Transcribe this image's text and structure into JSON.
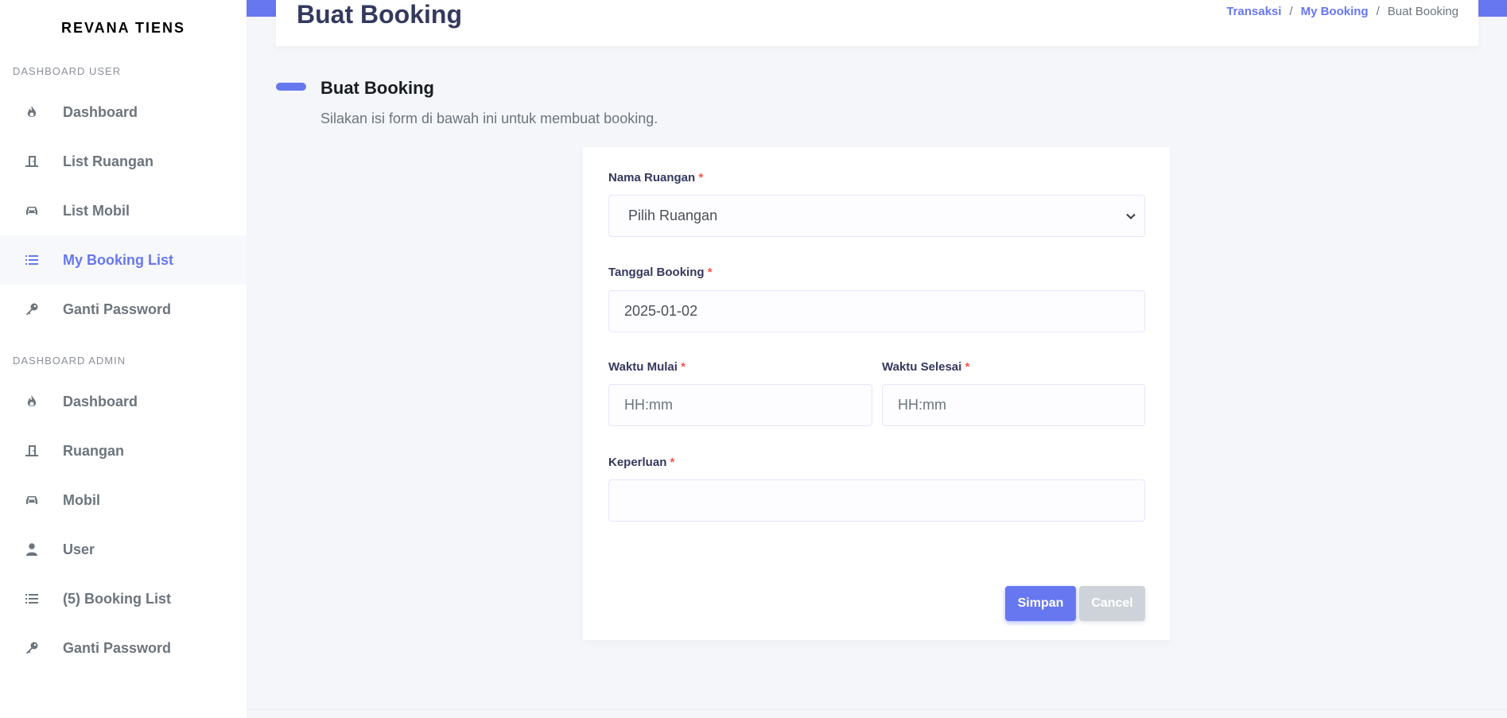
{
  "brand": "REVANA TIENS",
  "sidebar": {
    "user_header": "DASHBOARD USER",
    "user_items": [
      {
        "label": "Dashboard",
        "icon": "fire-icon"
      },
      {
        "label": "List Ruangan",
        "icon": "door-icon"
      },
      {
        "label": "List Mobil",
        "icon": "car-icon"
      },
      {
        "label": "My Booking List",
        "icon": "list-icon",
        "active": true
      },
      {
        "label": "Ganti Password",
        "icon": "key-icon"
      }
    ],
    "admin_header": "DASHBOARD ADMIN",
    "admin_items": [
      {
        "label": "Dashboard",
        "icon": "fire-icon"
      },
      {
        "label": "Ruangan",
        "icon": "door-icon"
      },
      {
        "label": "Mobil",
        "icon": "car-icon"
      },
      {
        "label": "User",
        "icon": "user-icon"
      },
      {
        "label": "(5) Booking List",
        "icon": "list-icon"
      },
      {
        "label": "Ganti Password",
        "icon": "key-icon"
      }
    ]
  },
  "header": {
    "title": "Buat Booking",
    "breadcrumb": [
      "Transaksi",
      "My Booking",
      "Buat Booking"
    ],
    "separator": "/"
  },
  "section": {
    "title": "Buat Booking",
    "lead": "Silakan isi form di bawah ini untuk membuat booking."
  },
  "form": {
    "required_mark": "*",
    "room_label": "Nama Ruangan",
    "room_value": "Pilih Ruangan",
    "date_label": "Tanggal Booking",
    "date_value": "2025-01-02",
    "start_label": "Waktu Mulai",
    "start_placeholder": "HH:mm",
    "end_label": "Waktu Selesai",
    "end_placeholder": "HH:mm",
    "purpose_label": "Keperluan",
    "purpose_value": "",
    "save_label": "Simpan",
    "cancel_label": "Cancel"
  },
  "colors": {
    "primary": "#6777ef",
    "required": "#fc544b",
    "cancel": "#cdd3d8"
  }
}
